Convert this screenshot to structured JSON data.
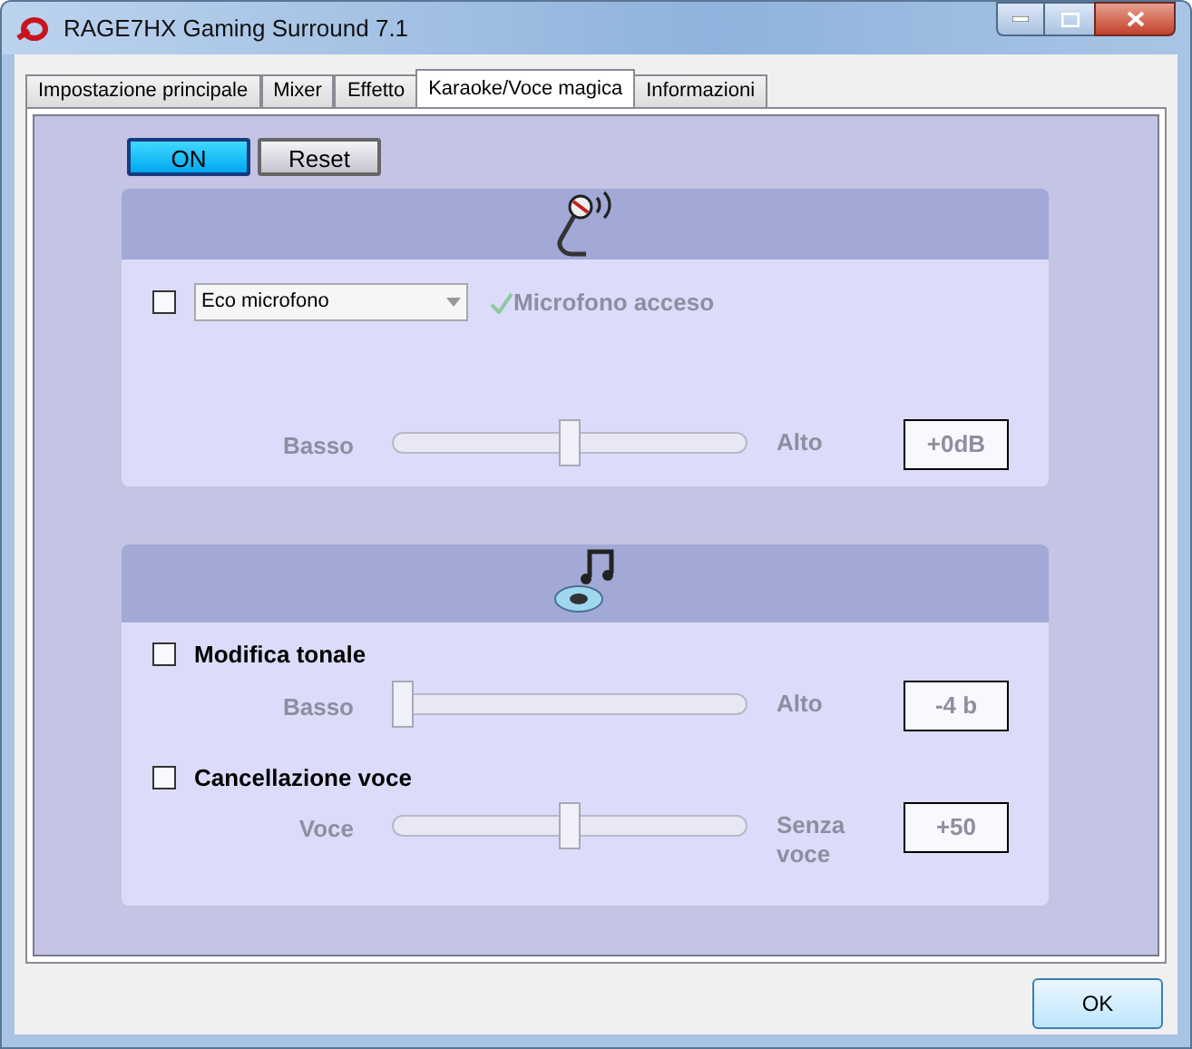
{
  "window": {
    "title": "RAGE7HX Gaming Surround 7.1"
  },
  "tabs": [
    {
      "label": "Impostazione principale",
      "selected": false
    },
    {
      "label": "Mixer",
      "selected": false
    },
    {
      "label": "Effetto",
      "selected": false
    },
    {
      "label": "Karaoke/Voce magica",
      "selected": true
    },
    {
      "label": "Informazioni",
      "selected": false
    }
  ],
  "toolbar": {
    "on_button": {
      "label": "ON",
      "on": true
    },
    "reset_button": {
      "label": "Reset"
    }
  },
  "microphone_panel": {
    "checked": false,
    "dropdown": {
      "value": "Eco microfono"
    },
    "status": {
      "label": "Microfono acceso",
      "disabled": true
    },
    "slider": {
      "min_label": "Basso",
      "max_label": "Alto",
      "level": 0.5,
      "reading": "+0dB",
      "disabled": true
    }
  },
  "music_panel": {
    "rows": [
      {
        "label": "Modifica tonale",
        "checked": false,
        "slider": {
          "min_label": "Basso",
          "max_label": "Alto",
          "level": 0.0,
          "reading": "-4 b",
          "disabled": true
        }
      },
      {
        "label": "Cancellazione voce",
        "checked": false,
        "slider": {
          "min_label": "Voce",
          "max_label": "Senza voce",
          "level": 0.5,
          "reading": "+50",
          "disabled": true
        }
      }
    ]
  },
  "buttons": [
    {
      "label": "OK"
    }
  ]
}
